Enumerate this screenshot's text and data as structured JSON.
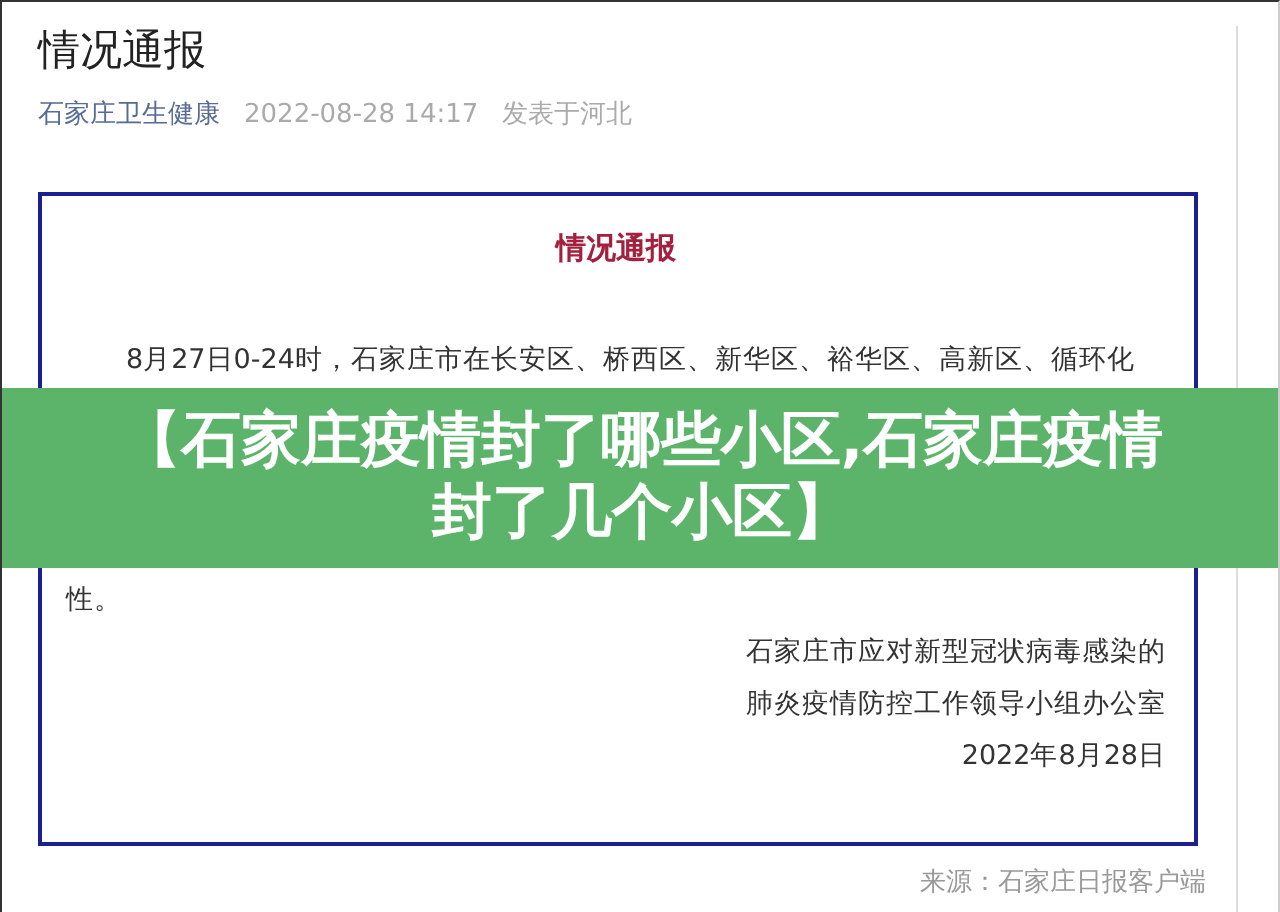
{
  "article": {
    "title": "情况通报",
    "author": "石家庄卫生健康",
    "datetime": "2022-08-28 14:17",
    "location": "发表于河北"
  },
  "notice": {
    "heading": "情况通报",
    "paragraph_lines": [
      "8月27日0-24时，石家庄市在长安区、桥西区、新华区、裕华区、高新区、循环化",
      "性。"
    ],
    "signature": [
      "石家庄市应对新型冠状病毒感染的",
      "肺炎疫情防控工作领导小组办公室",
      "2022年8月28日"
    ]
  },
  "source": "来源：石家庄日报客户端",
  "banner": {
    "title": "【石家庄疫情封了哪些小区,石家庄疫情封了几个小区】"
  }
}
